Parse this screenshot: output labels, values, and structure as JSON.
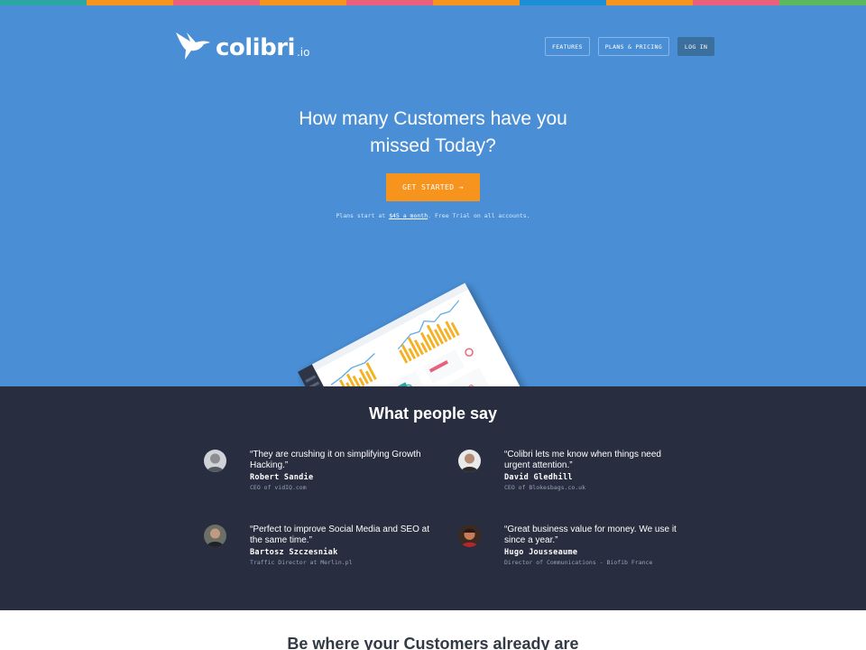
{
  "strip_colors": [
    "#2ca6a4",
    "#f7941d",
    "#e8607a",
    "#f7941d",
    "#e8607a",
    "#f7941d",
    "#1b8fd6",
    "#f7941d",
    "#e8607a",
    "#5cb85c"
  ],
  "colors": {
    "hero_bg": "#4a8fd6",
    "cta_bg": "#f7941d",
    "testimonials_bg": "#282d40",
    "login_bg": "#3a6f9e"
  },
  "header": {
    "logo_text": "colibri",
    "logo_tld": ".io",
    "logo_icon": "hummingbird-icon",
    "nav": {
      "features": "FEATURES",
      "pricing": "PLANS & PRICING",
      "login": "LOG IN"
    }
  },
  "hero": {
    "headline_line1": "How many Customers have you",
    "headline_line2": "missed Today?",
    "cta_label": "GET STARTED →",
    "plans_prefix": "Plans start at ",
    "plans_link": "$45 a month",
    "plans_suffix": ". Free Trial on all accounts."
  },
  "testimonials": {
    "title": "What people say",
    "items": [
      {
        "quote": "“They are crushing it on simplifying Growth Hacking.”",
        "author": "Robert Sandie",
        "role": "CEO of vidIQ.com"
      },
      {
        "quote": "“Colibri lets me know when things need urgent attention.”",
        "author": "David Gledhill",
        "role": "CEO of Blokesbags.co.uk"
      },
      {
        "quote": "“Perfect to improve Social Media and SEO at the same time.”",
        "author": "Bartosz Szczesniak",
        "role": "Traffic Director at Merlin.pl"
      },
      {
        "quote": "“Great business value for money. We use it since a year.”",
        "author": "Hugo Jousseaume",
        "role": "Director of Communications - Biofib France"
      }
    ]
  },
  "bottom": {
    "title": "Be where your Customers already are"
  }
}
